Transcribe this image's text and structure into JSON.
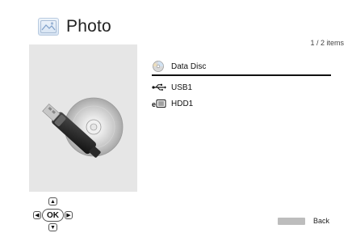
{
  "header": {
    "title": "Photo",
    "app_icon": "photo-icon",
    "item_count": "1 / 2 items"
  },
  "list": {
    "items": [
      {
        "label": "Data Disc",
        "icon": "disc-icon",
        "selected": true
      },
      {
        "label": "USB1",
        "icon": "usb-icon",
        "selected": false
      },
      {
        "label": "HDD1",
        "icon": "hdd-icon",
        "selected": false
      }
    ]
  },
  "navpad": {
    "ok_label": "OK",
    "up_icon": "arrow-up-icon",
    "down_icon": "arrow-down-icon",
    "left_icon": "arrow-left-icon",
    "right_icon": "arrow-right-icon"
  },
  "footer": {
    "back_label": "Back"
  },
  "colors": {
    "background": "#ffffff",
    "preview_panel": "#e6e6e6",
    "selection_line": "#111111",
    "back_key": "#bdbdbd"
  }
}
